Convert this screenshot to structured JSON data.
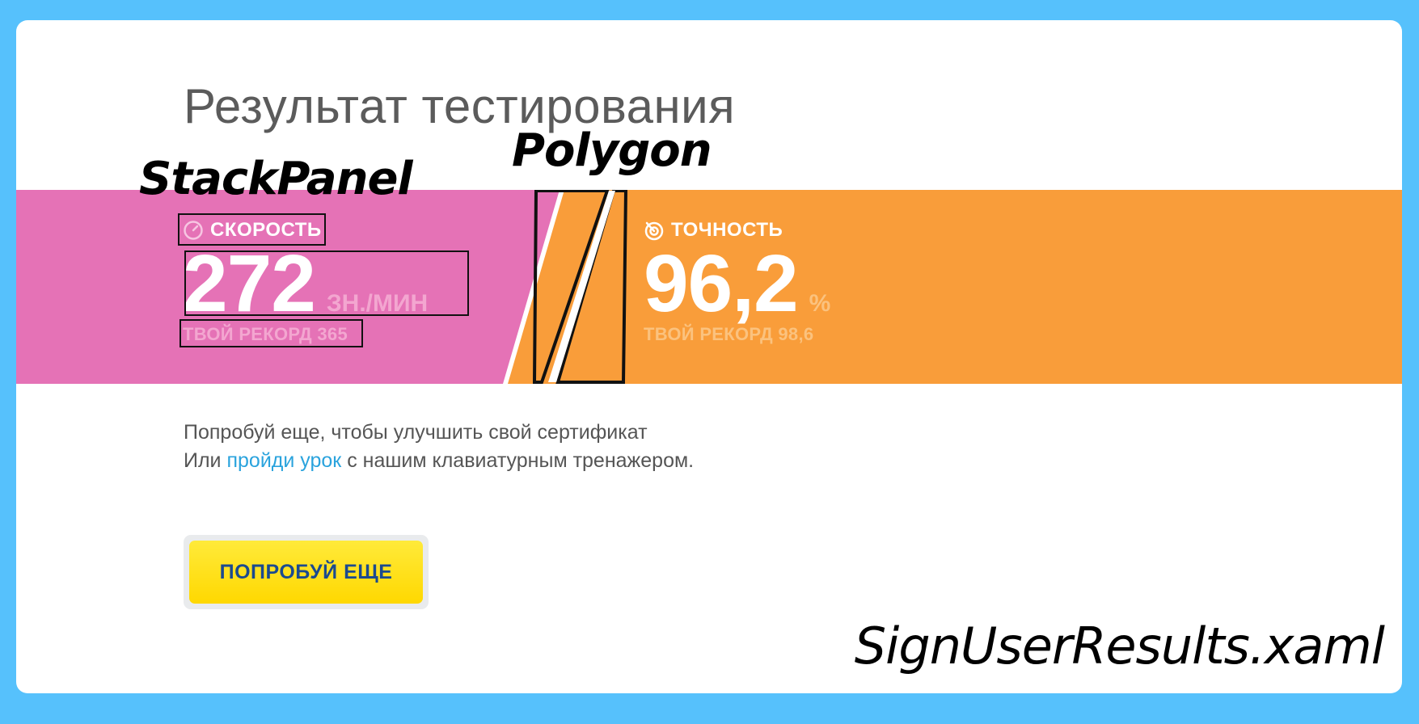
{
  "title": "Результат тестирования",
  "colors": {
    "frame": "#56c1fc",
    "speed_band": "#e572b6",
    "accuracy_band": "#f99d3a",
    "button": "#ffe01a",
    "link": "#2aa3dd"
  },
  "speed": {
    "icon": "speedometer-icon",
    "label": "СКОРОСТЬ",
    "value": "272",
    "unit": "ЗН./МИН",
    "record": "ТВОЙ РЕКОРД 365"
  },
  "accuracy": {
    "icon": "target-icon",
    "label": "ТОЧНОСТЬ",
    "value": "96,2",
    "unit": "%",
    "record": "ТВОЙ РЕКОРД 98,6"
  },
  "message": {
    "line1": "Попробуй еще, чтобы улучшить свой сертификат",
    "line2_prefix": "Или ",
    "line2_link": "пройди урок",
    "line2_suffix": " с нашим клавиатурным тренажером."
  },
  "button_label": "ПОПРОБУЙ ЕЩЕ",
  "annotations": {
    "stackpanel": "StackPanel",
    "polygon": "Polygon",
    "filename": "SignUserResults.xaml"
  }
}
